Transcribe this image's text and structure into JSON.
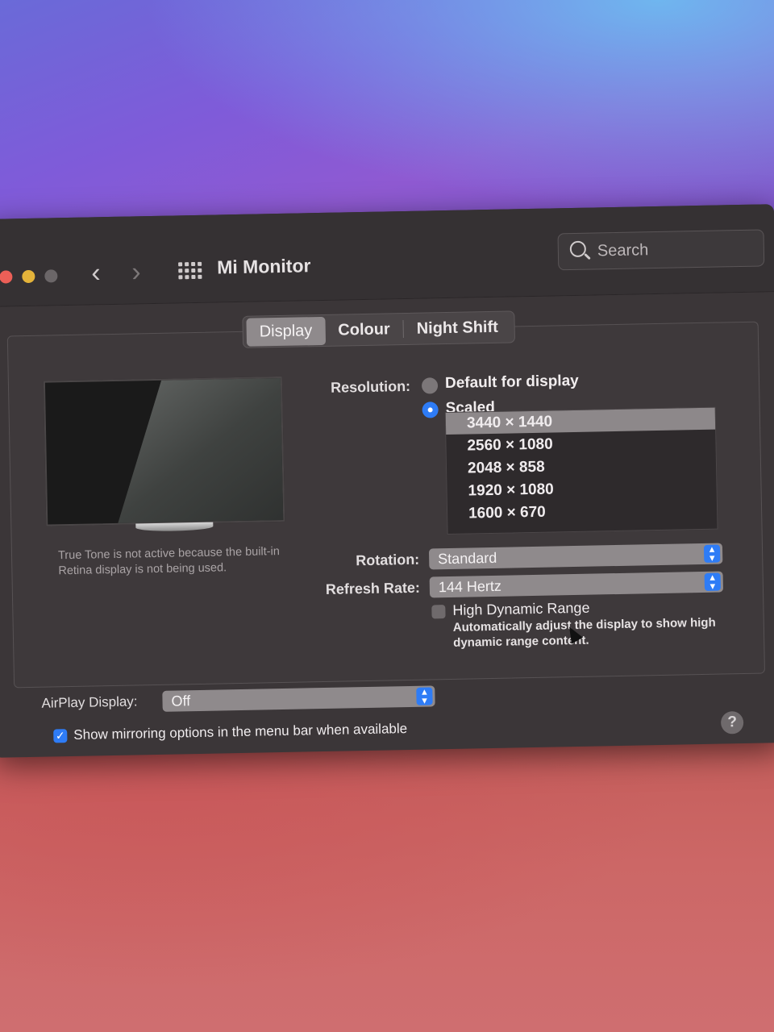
{
  "window": {
    "title": "Mi Monitor"
  },
  "search": {
    "placeholder": "Search"
  },
  "tabs": [
    {
      "label": "Display",
      "active": true
    },
    {
      "label": "Colour",
      "active": false
    },
    {
      "label": "Night Shift",
      "active": false
    }
  ],
  "display": {
    "true_tone_note": "True Tone is not active because the built-in Retina display is not being used.",
    "resolution": {
      "label": "Resolution:",
      "options": [
        {
          "label": "Default for display",
          "selected": false
        },
        {
          "label": "Scaled",
          "selected": true
        }
      ],
      "scaled_list": [
        "3440 × 1440",
        "2560 × 1080",
        "2048 × 858",
        "1920 × 1080",
        "1600 × 670"
      ],
      "selected_scaled": "3440 × 1440"
    },
    "rotation": {
      "label": "Rotation:",
      "value": "Standard"
    },
    "refresh_rate": {
      "label": "Refresh Rate:",
      "value": "144 Hertz"
    },
    "hdr": {
      "label": "High Dynamic Range",
      "checked": false,
      "description": "Automatically adjust the display to show high dynamic range content."
    }
  },
  "airplay": {
    "label": "AirPlay Display:",
    "value": "Off"
  },
  "mirroring": {
    "label": "Show mirroring options in the menu bar when available",
    "checked": true
  },
  "help": {
    "label": "?"
  },
  "colors": {
    "accent": "#2e7cf6",
    "window_bg": "#3b3638",
    "selected_row": "#8d888a"
  }
}
